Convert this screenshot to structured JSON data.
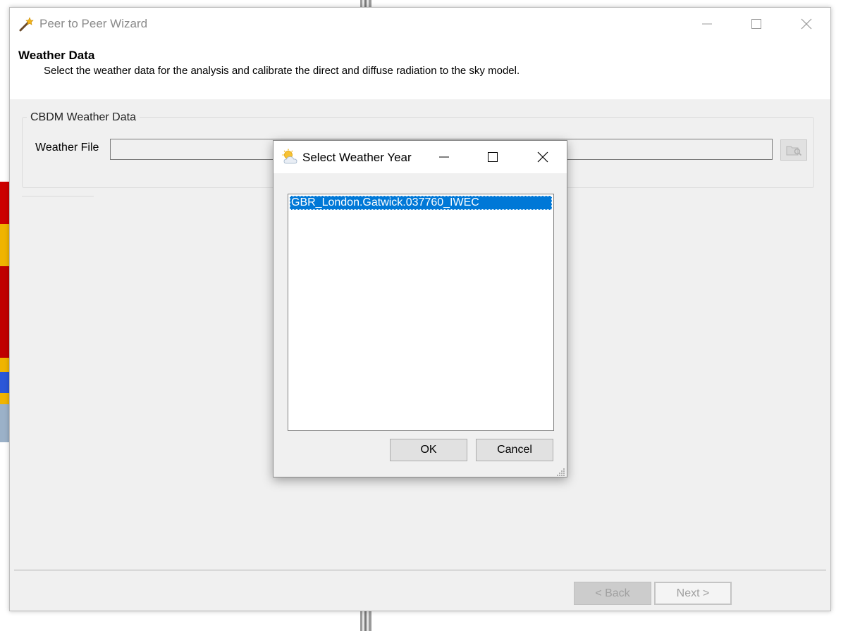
{
  "window": {
    "title": "Peer to Peer Wizard"
  },
  "header": {
    "title": "Weather Data",
    "subtitle": "Select the weather data for the analysis and calibrate the direct and diffuse radiation to the sky model."
  },
  "group": {
    "legend": "CBDM Weather Data",
    "weather_file_label": "Weather File",
    "weather_file_value": ""
  },
  "footer": {
    "back_label": "< Back",
    "next_label": "Next >"
  },
  "dialog": {
    "title": "Select Weather Year",
    "items": [
      {
        "label": "GBR_London.Gatwick.037760_IWEC",
        "selected": true
      }
    ],
    "ok_label": "OK",
    "cancel_label": "Cancel"
  },
  "icons": {
    "app": "magic-wand-icon",
    "dialog": "partly-cloudy-icon",
    "browse": "browse-folder-icon"
  },
  "colors": {
    "selection": "#0078d7",
    "disabled_text": "#a0a0a0"
  }
}
